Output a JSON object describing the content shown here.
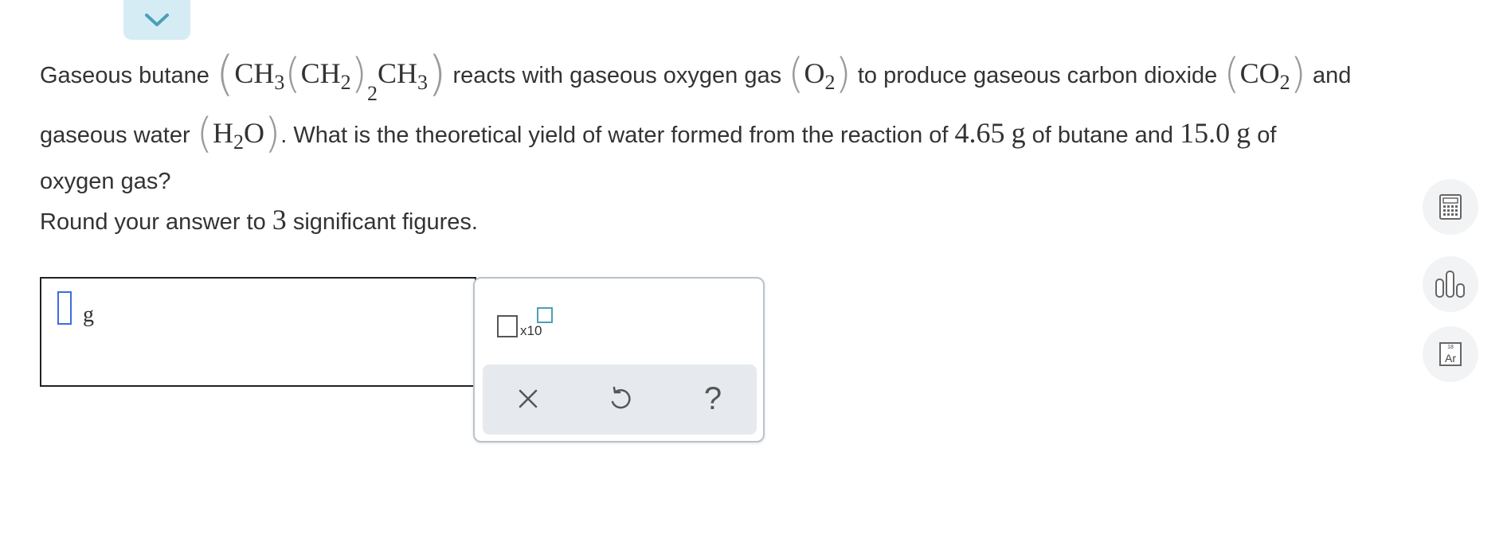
{
  "question": {
    "intro": "Gaseous butane",
    "butane_formula": {
      "ch": "CH",
      "sub3": "3",
      "ch2": "CH",
      "sub2": "2",
      "outer_sub": "2"
    },
    "reacts": "reacts with gaseous oxygen gas",
    "o2": {
      "o": "O",
      "sub": "2"
    },
    "produce": "to produce gaseous carbon dioxide",
    "co2": {
      "co": "CO",
      "sub": "2"
    },
    "and": "and",
    "water_text": "gaseous water",
    "h2o": {
      "h": "H",
      "sub": "2",
      "o": "O"
    },
    "after_water": ". What is the theoretical yield of water formed from the reaction of",
    "butane_mass": "4.65",
    "unit_g": "g",
    "of_butane_and": "of butane and",
    "oxygen_mass": "15.0",
    "of": "of",
    "end": "oxygen gas?"
  },
  "instruction": {
    "prefix": "Round your answer to",
    "sig_figs": "3",
    "suffix": "significant figures."
  },
  "answer": {
    "value": "",
    "unit": "g"
  },
  "keypad": {
    "sci_label": "x10",
    "clear_symbol": "×",
    "undo_icon": "undo-icon",
    "help_symbol": "?"
  },
  "tools": [
    {
      "name": "calculator-icon"
    },
    {
      "name": "data-chart-icon"
    },
    {
      "name": "periodic-table-icon",
      "element_number": "18",
      "element_symbol": "Ar"
    }
  ],
  "colors": {
    "accent": "#4aa0b8",
    "collapse_tab_bg": "#d6ecf4",
    "keypad_bar": "#e6e9ed",
    "cursor": "#3d6ce0"
  }
}
